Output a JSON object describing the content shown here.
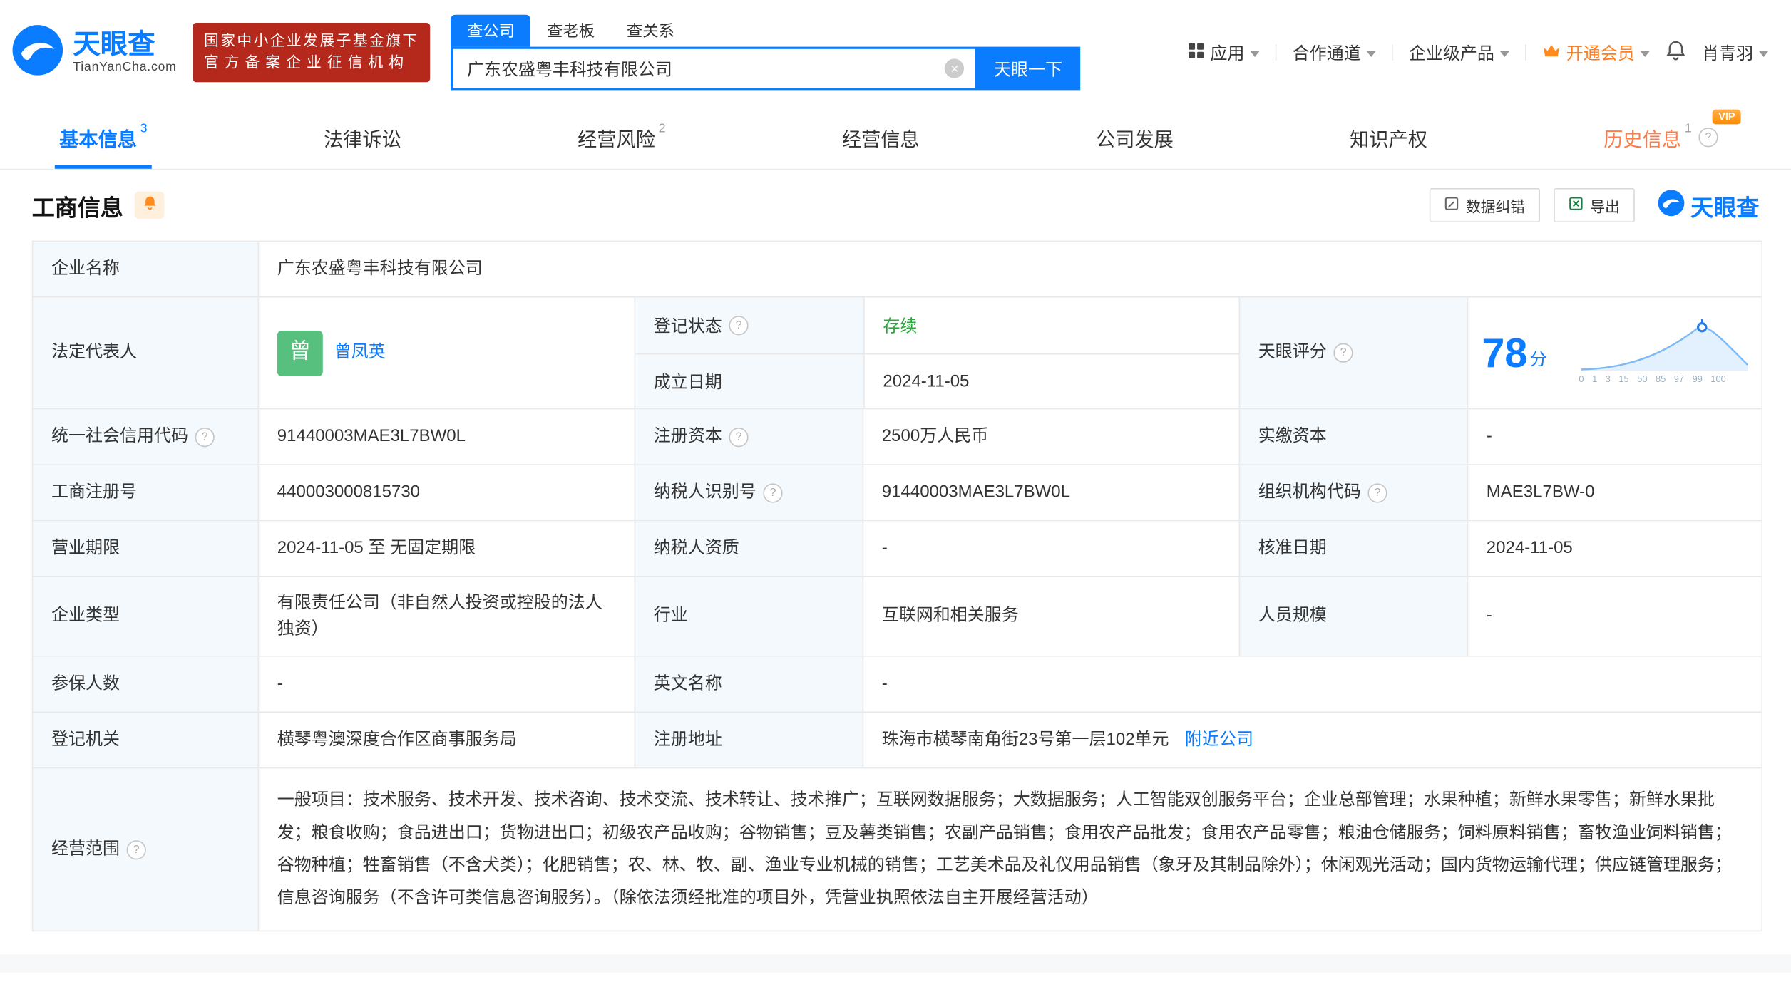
{
  "icons": {
    "help": "?",
    "clear": "×",
    "vip": "VIP"
  },
  "colors": {
    "brand_blue": "#0c7cff",
    "status_green": "#2aa93c",
    "member_orange": "#ff7d1f",
    "badge_red": "#b5291d"
  },
  "header": {
    "brand": {
      "name": "天眼查",
      "domain": "TianYanCha.com"
    },
    "cert_badge": {
      "line1": "国家中小企业发展子基金旗下",
      "line2": "官方备案企业征信机构"
    },
    "search": {
      "tabs": [
        {
          "label": "查公司"
        },
        {
          "label": "查老板"
        },
        {
          "label": "查关系"
        }
      ],
      "value": "广东农盛粤丰科技有限公司",
      "button": "天眼一下"
    },
    "nav": [
      {
        "label": "应用"
      },
      {
        "label": "合作通道"
      },
      {
        "label": "企业级产品"
      },
      {
        "label": "开通会员"
      }
    ],
    "user": "肖青羽"
  },
  "tabs": [
    {
      "label": "基本信息",
      "count": "3"
    },
    {
      "label": "法律诉讼"
    },
    {
      "label": "经营风险",
      "count": "2"
    },
    {
      "label": "经营信息"
    },
    {
      "label": "公司发展"
    },
    {
      "label": "知识产权"
    },
    {
      "label": "历史信息",
      "count": "1"
    }
  ],
  "section": {
    "title": "工商信息",
    "correct_btn": "数据纠错",
    "export_btn": "导出",
    "watermark": "天眼查"
  },
  "info": {
    "name_label": "企业名称",
    "name": "广东农盛粤丰科技有限公司",
    "legal_label": "法定代表人",
    "legal_avatar": "曾",
    "legal_name": "曾凤英",
    "status_label": "登记状态",
    "status": "存续",
    "established_label": "成立日期",
    "established": "2024-11-05",
    "score_label": "天眼评分",
    "score": "78",
    "score_unit": "分",
    "score_axis": "0 1 3 15 50 85 97 99 100",
    "uscc_label": "统一社会信用代码",
    "uscc": "91440003MAE3L7BW0L",
    "reg_capital_label": "注册资本",
    "reg_capital": "2500万人民币",
    "paid_capital_label": "实缴资本",
    "paid_capital": "-",
    "reg_no_label": "工商注册号",
    "reg_no": "440003000815730",
    "taxpayer_label": "纳税人识别号",
    "taxpayer": "91440003MAE3L7BW0L",
    "org_code_label": "组织机构代码",
    "org_code": "MAE3L7BW-0",
    "term_label": "营业期限",
    "term": "2024-11-05 至 无固定期限",
    "tax_qual_label": "纳税人资质",
    "tax_qual": "-",
    "approval_label": "核准日期",
    "approval": "2024-11-05",
    "type_label": "企业类型",
    "type": "有限责任公司（非自然人投资或控股的法人独资）",
    "industry_label": "行业",
    "industry": "互联网和相关服务",
    "staff_label": "人员规模",
    "staff": "-",
    "insured_label": "参保人数",
    "insured": "-",
    "en_name_label": "英文名称",
    "en_name": "-",
    "authority_label": "登记机关",
    "authority": "横琴粤澳深度合作区商事服务局",
    "address_label": "注册地址",
    "address": "珠海市横琴南角街23号第一层102单元",
    "nearby": "附近公司",
    "scope_label": "经营范围",
    "scope": "一般项目：技术服务、技术开发、技术咨询、技术交流、技术转让、技术推广；互联网数据服务；大数据服务；人工智能双创服务平台；企业总部管理；水果种植；新鲜水果零售；新鲜水果批发；粮食收购；食品进出口；货物进出口；初级农产品收购；谷物销售；豆及薯类销售；农副产品销售；食用农产品批发；食用农产品零售；粮油仓储服务；饲料原料销售；畜牧渔业饲料销售；谷物种植；牲畜销售（不含犬类）；化肥销售；农、林、牧、副、渔业专业机械的销售；工艺美术品及礼仪用品销售（象牙及其制品除外）；休闲观光活动；国内货物运输代理；供应链管理服务；信息咨询服务（不含许可类信息咨询服务）。（除依法须经批准的项目外，凭营业执照依法自主开展经营活动）"
  }
}
